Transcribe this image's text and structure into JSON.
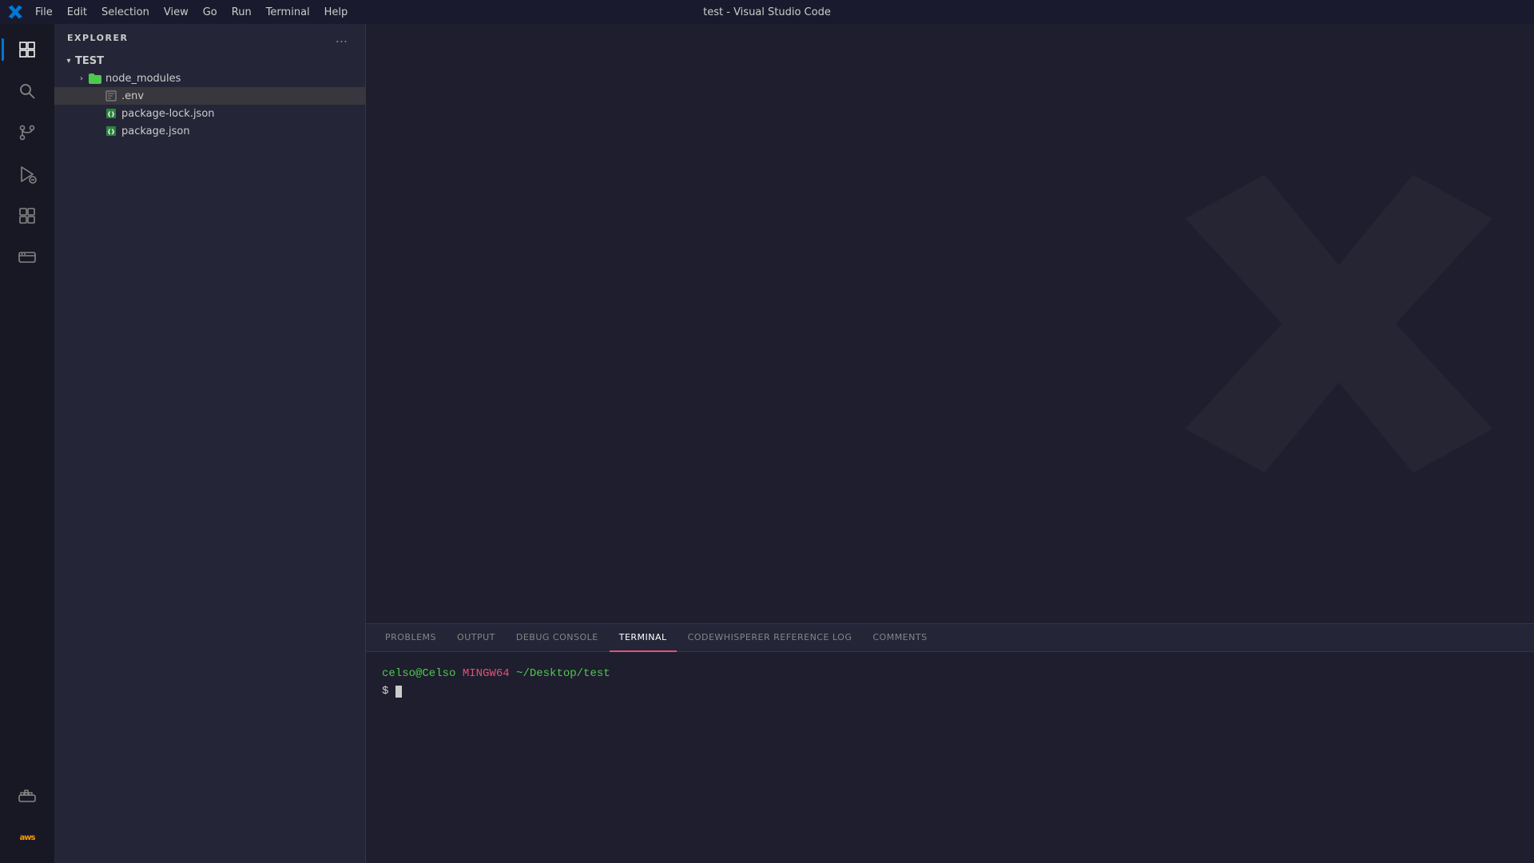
{
  "titlebar": {
    "title": "test - Visual Studio Code",
    "menu_items": [
      "File",
      "Edit",
      "Selection",
      "View",
      "Go",
      "Run",
      "Terminal",
      "Help"
    ]
  },
  "activity_bar": {
    "items": [
      {
        "name": "explorer",
        "label": "Explorer",
        "active": true
      },
      {
        "name": "search",
        "label": "Search"
      },
      {
        "name": "source-control",
        "label": "Source Control"
      },
      {
        "name": "run-debug",
        "label": "Run and Debug"
      },
      {
        "name": "extensions",
        "label": "Extensions"
      },
      {
        "name": "remote-explorer",
        "label": "Remote Explorer"
      }
    ],
    "bottom_items": [
      {
        "name": "docker",
        "label": "Docker"
      },
      {
        "name": "aws",
        "label": "AWS"
      }
    ]
  },
  "sidebar": {
    "title": "EXPLORER",
    "more_label": "...",
    "root_folder": "TEST",
    "tree": [
      {
        "name": "node_modules",
        "type": "folder",
        "icon": "folder-green",
        "indent": 1,
        "expanded": false
      },
      {
        "name": ".env",
        "type": "file",
        "icon": "env",
        "indent": 2,
        "selected": true
      },
      {
        "name": "package-lock.json",
        "type": "file",
        "icon": "json",
        "indent": 2
      },
      {
        "name": "package.json",
        "type": "file",
        "icon": "json",
        "indent": 2
      }
    ]
  },
  "panel": {
    "tabs": [
      {
        "label": "PROBLEMS",
        "active": false
      },
      {
        "label": "OUTPUT",
        "active": false
      },
      {
        "label": "DEBUG CONSOLE",
        "active": false
      },
      {
        "label": "TERMINAL",
        "active": true
      },
      {
        "label": "CODEWHISPERER REFERENCE LOG",
        "active": false
      },
      {
        "label": "COMMENTS",
        "active": false
      }
    ]
  },
  "terminal": {
    "prompt_user": "celso@Celso",
    "prompt_env": "MINGW64",
    "prompt_path": "~/Desktop/test",
    "prompt_symbol": "$"
  }
}
